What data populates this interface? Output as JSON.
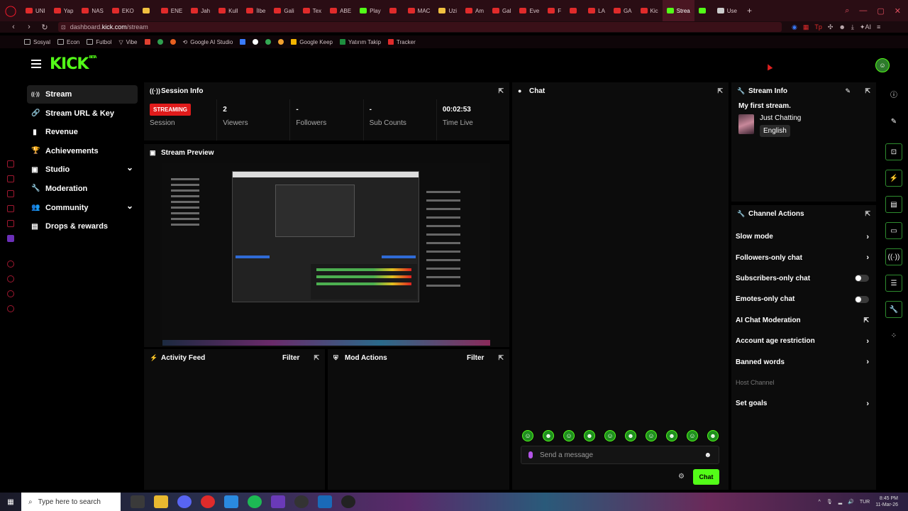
{
  "browser": {
    "tabs": [
      {
        "label": "UNI",
        "color": "red"
      },
      {
        "label": "Yap",
        "color": "red"
      },
      {
        "label": "NAS",
        "color": "red"
      },
      {
        "label": "EKO",
        "color": "red"
      },
      {
        "label": "",
        "color": "yellow"
      },
      {
        "label": "ENE",
        "color": "red"
      },
      {
        "label": "Jah",
        "color": "red"
      },
      {
        "label": "Kull",
        "color": "red"
      },
      {
        "label": "İlbe",
        "color": "red"
      },
      {
        "label": "Gali",
        "color": "red"
      },
      {
        "label": "Tex",
        "color": "red"
      },
      {
        "label": "ABE",
        "color": "red"
      },
      {
        "label": "Play",
        "color": "green"
      },
      {
        "label": "",
        "color": "red"
      },
      {
        "label": "MAC",
        "color": "red"
      },
      {
        "label": "Uzi",
        "color": "yellow"
      },
      {
        "label": "Am",
        "color": "red"
      },
      {
        "label": "Gal",
        "color": "red"
      },
      {
        "label": "Eve",
        "color": "red"
      },
      {
        "label": "F",
        "color": "red"
      },
      {
        "label": "",
        "color": "red"
      },
      {
        "label": "LA",
        "color": "red"
      },
      {
        "label": "GA",
        "color": "red"
      },
      {
        "label": "Kic",
        "color": "red"
      },
      {
        "label": "Strea",
        "color": "green",
        "active": true
      },
      {
        "label": "",
        "color": "green"
      },
      {
        "label": "Use",
        "color": "white"
      }
    ],
    "url_host": "dashboard.",
    "url_domain": "kick.com",
    "url_path": "/stream",
    "bookmarks": [
      "Sosyal",
      "Econ",
      "Futbol",
      "Vibe",
      "Google AI Studio",
      "Google Keep",
      "Yatırım Takip",
      "Tracker"
    ]
  },
  "header": {
    "logo": "KICK",
    "logo_sup": "BETA"
  },
  "nav": [
    {
      "label": "Stream",
      "icon": "broadcast-icon",
      "glyph": "((·))",
      "active": true
    },
    {
      "label": "Stream URL & Key",
      "icon": "link-icon",
      "glyph": "🔗"
    },
    {
      "label": "Revenue",
      "icon": "chart-icon",
      "glyph": "▮"
    },
    {
      "label": "Achievements",
      "icon": "trophy-icon",
      "glyph": "🏆"
    },
    {
      "label": "Studio",
      "icon": "studio-icon",
      "glyph": "▣",
      "expandable": true
    },
    {
      "label": "Moderation",
      "icon": "wrench-icon",
      "glyph": "🔧"
    },
    {
      "label": "Community",
      "icon": "people-icon",
      "glyph": "👥",
      "expandable": true
    },
    {
      "label": "Drops & rewards",
      "icon": "gift-icon",
      "glyph": "▤"
    }
  ],
  "session": {
    "title": "Session Info",
    "status_badge": "STREAMING",
    "status_label": "Session",
    "stats": [
      {
        "value": "2",
        "label": "Viewers"
      },
      {
        "value": "-",
        "label": "Followers"
      },
      {
        "value": "-",
        "label": "Sub Counts"
      },
      {
        "value": "00:02:53",
        "label": "Time Live"
      }
    ]
  },
  "preview": {
    "title": "Stream Preview"
  },
  "chat": {
    "title": "Chat",
    "placeholder": "Send a message",
    "send_label": "Chat"
  },
  "stream_info": {
    "title": "Stream Info",
    "stream_title": "My first stream.",
    "category": "Just Chatting",
    "language": "English"
  },
  "channel_actions": {
    "title": "Channel Actions",
    "items": [
      {
        "label": "Slow mode",
        "control": "arrow"
      },
      {
        "label": "Followers-only chat",
        "control": "arrow"
      },
      {
        "label": "Subscribers-only chat",
        "control": "toggle",
        "on": false
      },
      {
        "label": "Emotes-only chat",
        "control": "toggle",
        "on": false
      },
      {
        "label": "AI Chat Moderation",
        "control": "external"
      },
      {
        "label": "Account age restriction",
        "control": "arrow"
      },
      {
        "label": "Banned words",
        "control": "arrow"
      },
      {
        "label": "Host Channel",
        "control": "none",
        "muted": true
      },
      {
        "label": "Set goals",
        "control": "arrow"
      }
    ]
  },
  "activity_feed": {
    "title": "Activity Feed",
    "filter": "Filter"
  },
  "mod_actions": {
    "title": "Mod Actions",
    "filter": "Filter"
  },
  "taskbar": {
    "search_placeholder": "Type here to search",
    "lang": "TUR",
    "time": "8:45 PM",
    "date": "11-Mar-26"
  },
  "colors": {
    "accent": "#53fc18",
    "live": "#e01b1b",
    "browser_bg": "#2a0d14"
  }
}
